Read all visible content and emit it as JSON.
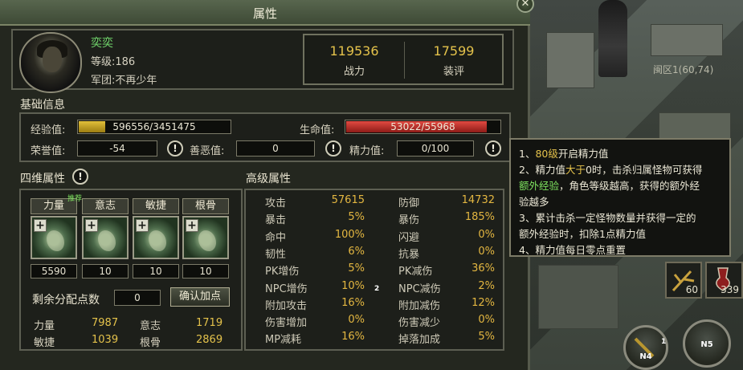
{
  "window": {
    "title": "属性",
    "close_icon": "✕"
  },
  "character": {
    "name": "奕奕",
    "level_text": "等级:186",
    "guild_text": "军团:不再少年"
  },
  "scores": [
    {
      "value": "119536",
      "label": "战力"
    },
    {
      "value": "17599",
      "label": "装评"
    }
  ],
  "basic": {
    "header": "基础信息",
    "exp_label": "经验值:",
    "exp_value": "596556/3451475",
    "exp_fraction": 0.173,
    "hp_label": "生命值:",
    "hp_value": "53022/55968",
    "hp_fraction": 0.947,
    "honor_label": "荣誉值:",
    "honor_value": "-54",
    "karma_label": "善恶值:",
    "karma_value": "0",
    "energy_label": "精力值:",
    "energy_value": "0/100"
  },
  "four_stats": {
    "header": "四维属性",
    "recommend": "推荐",
    "items": [
      {
        "name": "力量",
        "value": "5590"
      },
      {
        "name": "意志",
        "value": "10"
      },
      {
        "name": "敏捷",
        "value": "10"
      },
      {
        "name": "根骨",
        "value": "10"
      }
    ],
    "remaining_label": "剩余分配点数",
    "remaining_value": "0",
    "confirm_label": "确认加点",
    "summary": [
      {
        "name": "力量",
        "value": "7987"
      },
      {
        "name": "意志",
        "value": "1719"
      },
      {
        "name": "敏捷",
        "value": "1039"
      },
      {
        "name": "根骨",
        "value": "2869"
      }
    ]
  },
  "advanced": {
    "header": "高级属性",
    "left": [
      {
        "name": "攻击",
        "value": "57615"
      },
      {
        "name": "暴击",
        "value": "5%"
      },
      {
        "name": "命中",
        "value": "100%"
      },
      {
        "name": "韧性",
        "value": "6%"
      },
      {
        "name": "PK增伤",
        "value": "5%"
      },
      {
        "name": "NPC增伤",
        "value": "10%"
      },
      {
        "name": "附加攻击",
        "value": "16%"
      },
      {
        "name": "伤害增加",
        "value": "0%"
      },
      {
        "name": "MP减耗",
        "value": "16%"
      }
    ],
    "right": [
      {
        "name": "防御",
        "value": "14732"
      },
      {
        "name": "暴伤",
        "value": "185%"
      },
      {
        "name": "闪避",
        "value": "0%"
      },
      {
        "name": "抗暴",
        "value": "0%"
      },
      {
        "name": "PK减伤",
        "value": "36%"
      },
      {
        "name": "NPC减伤",
        "value": "2%"
      },
      {
        "name": "附加减伤",
        "value": "12%"
      },
      {
        "name": "伤害减少",
        "value": "0%"
      },
      {
        "name": "掉落加成",
        "value": "5%"
      }
    ],
    "center_mark": "2"
  },
  "tooltip": {
    "l1_a": "1、",
    "l1_b": "80级",
    "l1_c": "开启精力值",
    "l2_a": "2、精力值",
    "l2_b": "大于",
    "l2_c": "0时，击杀归属怪物可获得",
    "l3_a": "额外经验",
    "l3_b": "，角色等级越高，获得的额外经",
    "l4": "验越多",
    "l5": "3、累计击杀一定怪物数量并获得一定的",
    "l6": "额外经验时，扣除1点精力值",
    "l7": "4、精力值每日零点重置"
  },
  "world": {
    "zone": "闽区1(60,74)",
    "pk_mode": "和平",
    "slots": [
      {
        "count": "60"
      },
      {
        "count": "339"
      }
    ],
    "buttons": [
      {
        "label": "N4",
        "badge": "1"
      },
      {
        "label": "N5"
      }
    ]
  },
  "colors": {
    "exp_bar": "#c9a71f",
    "hp_bar": "#c9302b",
    "accent": "#e4c24b",
    "name": "#6fd16a"
  }
}
